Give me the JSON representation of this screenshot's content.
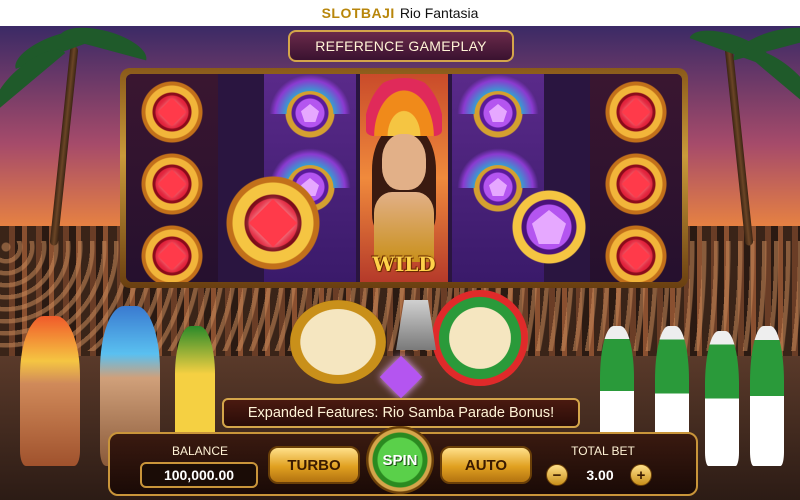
{
  "app": {
    "brand": "SLOTBAJI",
    "title": "Rio Fantasia"
  },
  "game": {
    "plaque_text": "REFERENCE GAMEPLAY",
    "wild_label": "WILD",
    "features_banner": "Expanded Features: Rio Samba Parade Bonus!"
  },
  "controls": {
    "balance_label": "BALANCE",
    "balance_value": "100,000.00",
    "turbo_label": "TURBO",
    "spin_label": "SPIN",
    "auto_label": "AUTO",
    "total_bet_label": "TOTAL BET",
    "total_bet_value": "3.00",
    "minus_symbol": "−",
    "plus_symbol": "+"
  },
  "colors": {
    "gold": "#d4a54a",
    "spin_green": "#2a8a20",
    "ruby": "#e0203a",
    "amethyst": "#b455f0"
  }
}
